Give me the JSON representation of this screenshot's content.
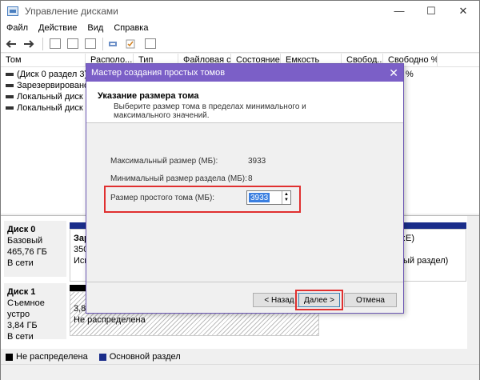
{
  "window": {
    "title": "Управление дисками",
    "ctrl_min": "—",
    "ctrl_max": "☐",
    "ctrl_close": "✕"
  },
  "menu": [
    "Файл",
    "Действие",
    "Вид",
    "Справка"
  ],
  "columns": [
    "Том",
    "Располо...",
    "Тип",
    "Файловая с...",
    "Состояние",
    "Емкость",
    "Свобод...",
    "Свободно %"
  ],
  "volumes": [
    "(Диск 0 раздел 3)",
    "Зарезервировано...",
    "Локальный диск ...",
    "Локальный диск ..."
  ],
  "right_fragments": {
    "pct": "%",
    "e_label": ":E)",
    "part_text": "ый раздел)"
  },
  "disks": [
    {
      "name": "Диск 0",
      "type": "Базовый",
      "size": "465,76 ГБ",
      "status": "В сети",
      "part_title": "Зар",
      "part_line2": "350",
      "part_line3": "Исп"
    },
    {
      "name": "Диск 1",
      "type": "Съемное устро",
      "size": "3,84 ГБ",
      "status": "В сети",
      "part_line1": "3,84",
      "part_line2": "Не распределена"
    }
  ],
  "legend": [
    {
      "label": "Не распределена",
      "color": "#000000"
    },
    {
      "label": "Основной раздел",
      "color": "#1a2d8a"
    }
  ],
  "dialog": {
    "title": "Мастер создания простых томов",
    "close": "✕",
    "heading": "Указание размера тома",
    "subheading": "Выберите размер тома в пределах минимального и максимального значений.",
    "max_label": "Максимальный размер (МБ):",
    "max_value": "3933",
    "min_label": "Минимальный размер раздела (МБ):",
    "min_value": "8",
    "size_label": "Размер простого тома (МБ):",
    "size_value": "3933",
    "back_button": "< Назад",
    "next_button": "Далее >",
    "cancel_button": "Отмена"
  },
  "colors": {
    "accent": "#7b5fc7",
    "highlight": "#e03030",
    "primary_partition": "#1a2d8a"
  }
}
